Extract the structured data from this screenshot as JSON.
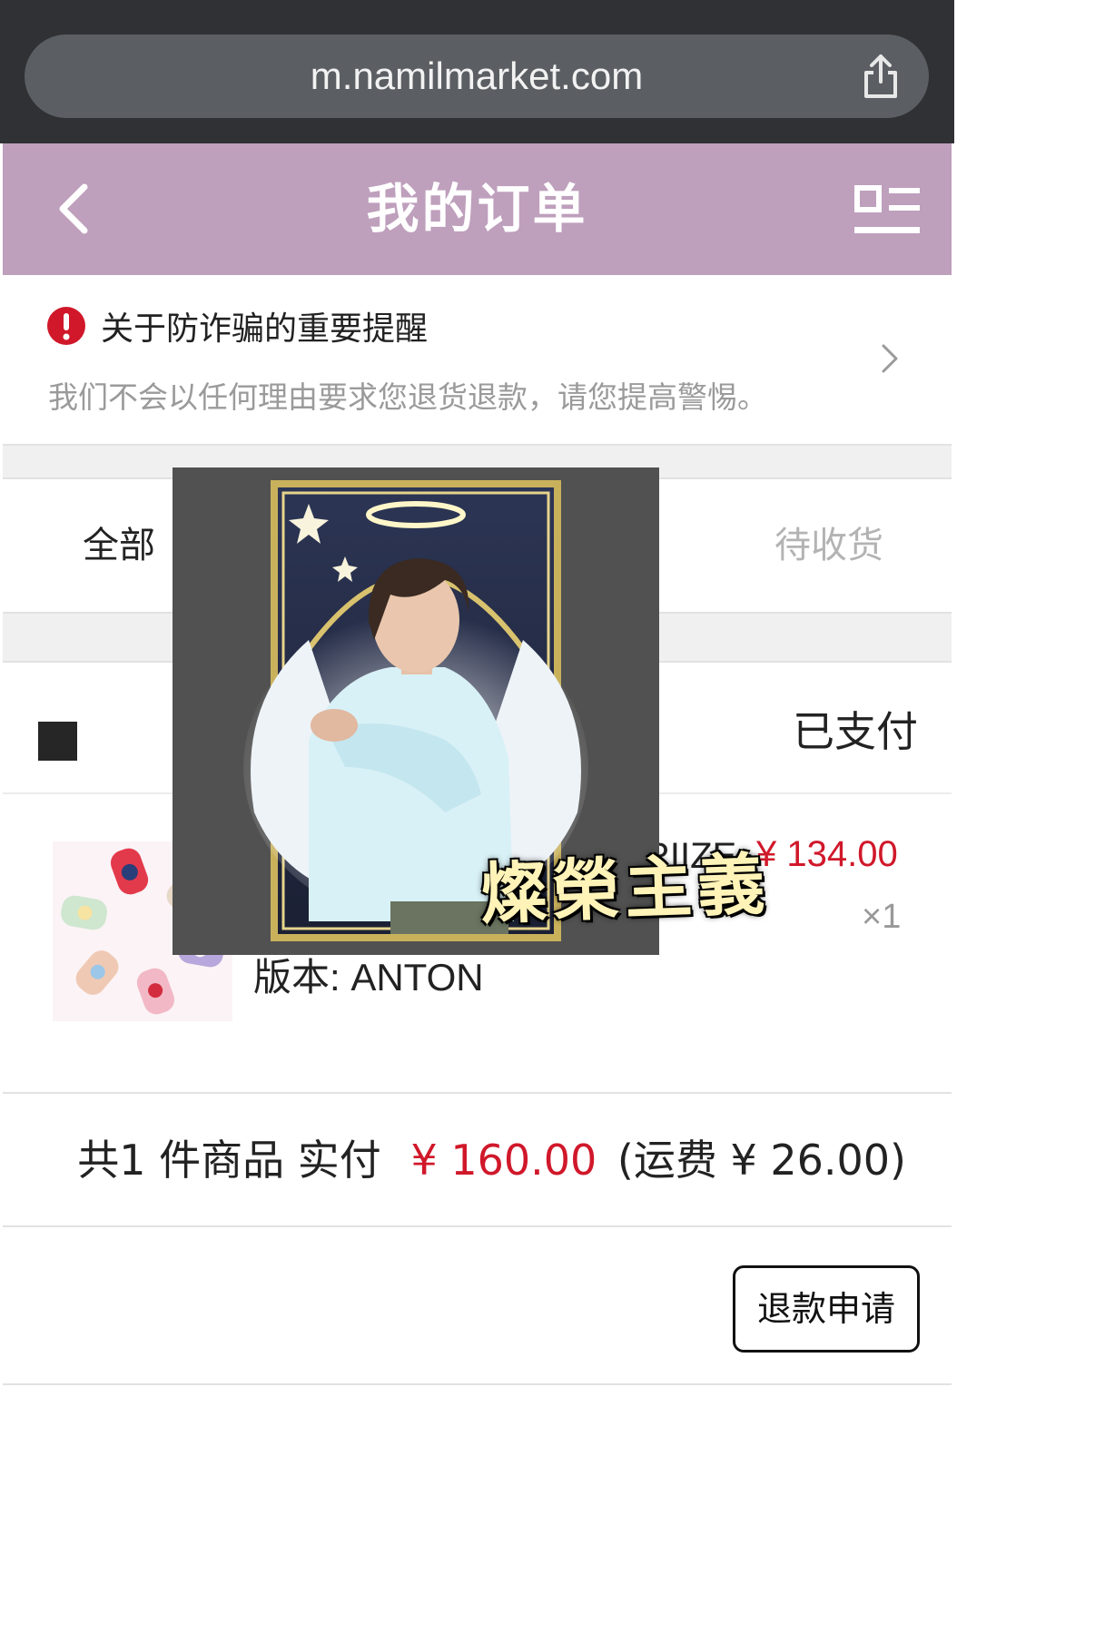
{
  "browser": {
    "url": "m.namilmarket.com",
    "share_icon": "share-icon"
  },
  "header": {
    "title": "我的订单",
    "back_icon": "chevron-left-icon",
    "menu_icon": "list-menu-icon",
    "bg": "#be9fbc"
  },
  "notice": {
    "title": "关于防诈骗的重要提醒",
    "subtitle": "我们不会以任何理由要求您退货退款，请您提高警惕。",
    "icon": "alert-icon",
    "icon_color": "#d0182a"
  },
  "tabs": {
    "all": "全部",
    "pending": "待收货"
  },
  "order": {
    "status": "已支付",
    "item": {
      "name_fragment": "RIIZE",
      "price": "¥ 134.00",
      "quantity": "×1",
      "variant": "版本: ANTON"
    },
    "summary": {
      "count_text": "共1 件商品  实付",
      "total": "¥ 160.00",
      "shipping": "(运费 ¥ 26.00)"
    },
    "refund_button": "退款申请"
  },
  "overlay": {
    "caption": "燦榮主義"
  },
  "colors": {
    "accent_red": "#d0182a",
    "header_purple": "#be9fbc"
  }
}
